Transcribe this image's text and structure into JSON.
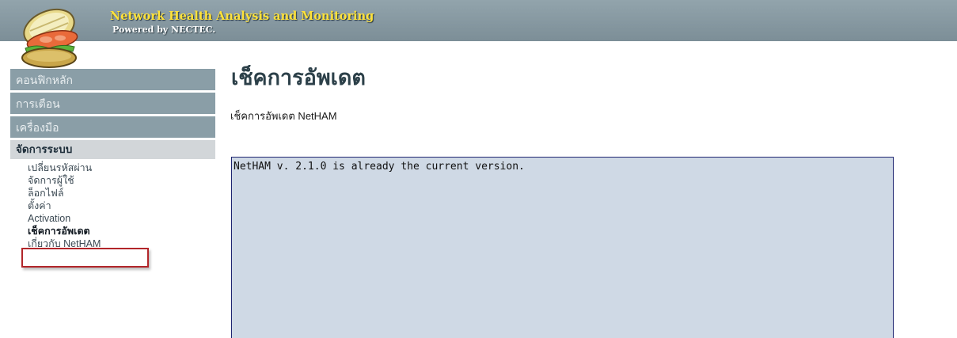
{
  "header": {
    "title": "Network Health Analysis and Monitoring",
    "subtitle": "Powered by NECTEC.",
    "logo_icon": "sandwich-logo-icon"
  },
  "sidebar": {
    "sections": [
      {
        "label": "คอนฟิกหลัก"
      },
      {
        "label": "การเตือน"
      },
      {
        "label": "เครื่องมือ"
      }
    ],
    "active_section": {
      "label": "จัดการระบบ",
      "items": [
        {
          "label": "เปลี่ยนรหัสผ่าน"
        },
        {
          "label": "จัดการผู้ใช้"
        },
        {
          "label": "ล็อกไฟล์"
        },
        {
          "label": "ตั้งค่า"
        },
        {
          "label": "Activation"
        },
        {
          "label": "เช็คการอัพเดต"
        },
        {
          "label": "เกี่ยวกับ NetHAM"
        }
      ]
    }
  },
  "main": {
    "title": "เช็คการอัพเดต",
    "subtitle": "เช็คการอัพเดต NetHAM",
    "output": "NetHAM v. 2.1.0 is already the current version."
  },
  "colors": {
    "header_bg": "#8394a0",
    "brand_title": "#ffe23a",
    "sidebar_block": "#8a9ea7",
    "active_block": "#d2d6d9",
    "output_bg": "#cfd9e5",
    "highlight": "#b2262a"
  }
}
